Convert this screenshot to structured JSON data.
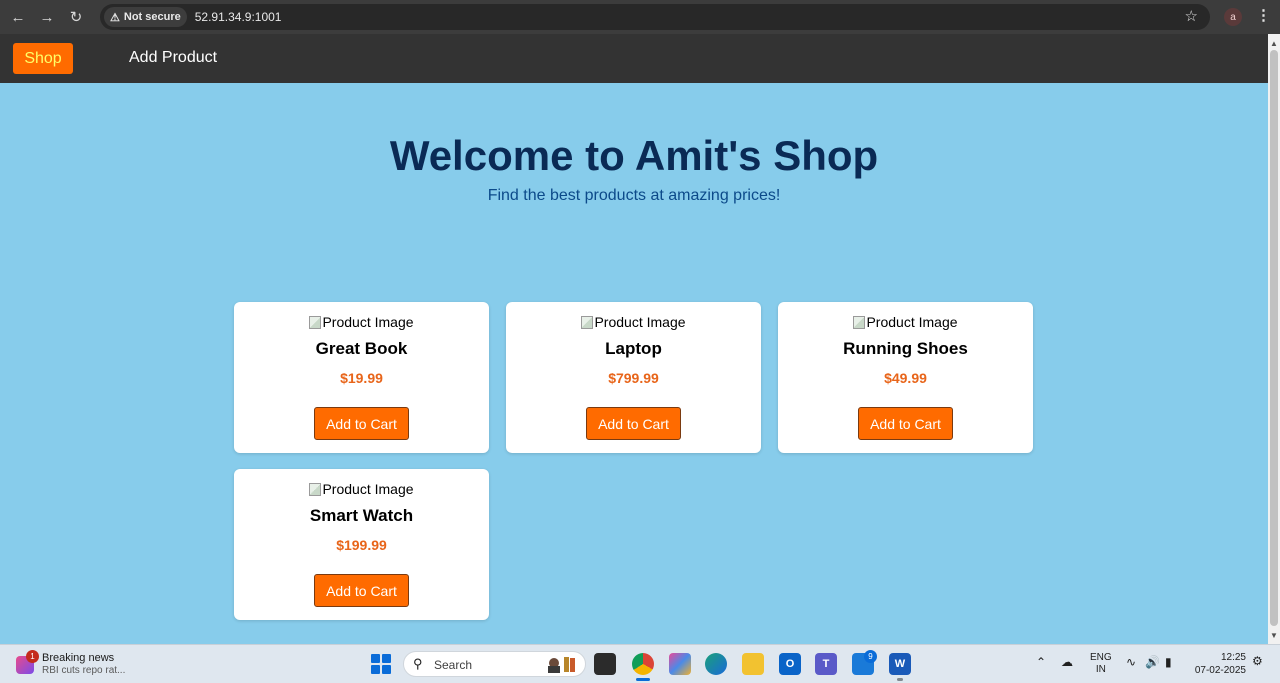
{
  "browser": {
    "security_label": "Not secure",
    "url": "52.91.34.9:1001",
    "profile_initial": "a"
  },
  "navbar": {
    "shop_label": "Shop",
    "add_product_label": "Add Product"
  },
  "hero": {
    "title": "Welcome to Amit's Shop",
    "subtitle": "Find the best products at amazing prices!"
  },
  "products": [
    {
      "image_alt": "Product Image",
      "name": "Great Book",
      "price": "$19.99",
      "button": "Add to Cart"
    },
    {
      "image_alt": "Product Image",
      "name": "Laptop",
      "price": "$799.99",
      "button": "Add to Cart"
    },
    {
      "image_alt": "Product Image",
      "name": "Running Shoes",
      "price": "$49.99",
      "button": "Add to Cart"
    },
    {
      "image_alt": "Product Image",
      "name": "Smart Watch",
      "price": "$199.99",
      "button": "Add to Cart"
    }
  ],
  "taskbar": {
    "news_badge": "1",
    "news_title": "Breaking news",
    "news_subtitle": "RBI cuts repo rat...",
    "search_placeholder": "Search",
    "teams_badge": "9",
    "language_line1": "ENG",
    "language_line2": "IN",
    "time": "12:25",
    "date": "07-02-2025"
  },
  "colors": {
    "page_background": "#87cceb",
    "accent_orange": "#ff6b00",
    "price_orange": "#e8651a",
    "navbar": "#333333",
    "title_navy": "#0a2a55"
  }
}
